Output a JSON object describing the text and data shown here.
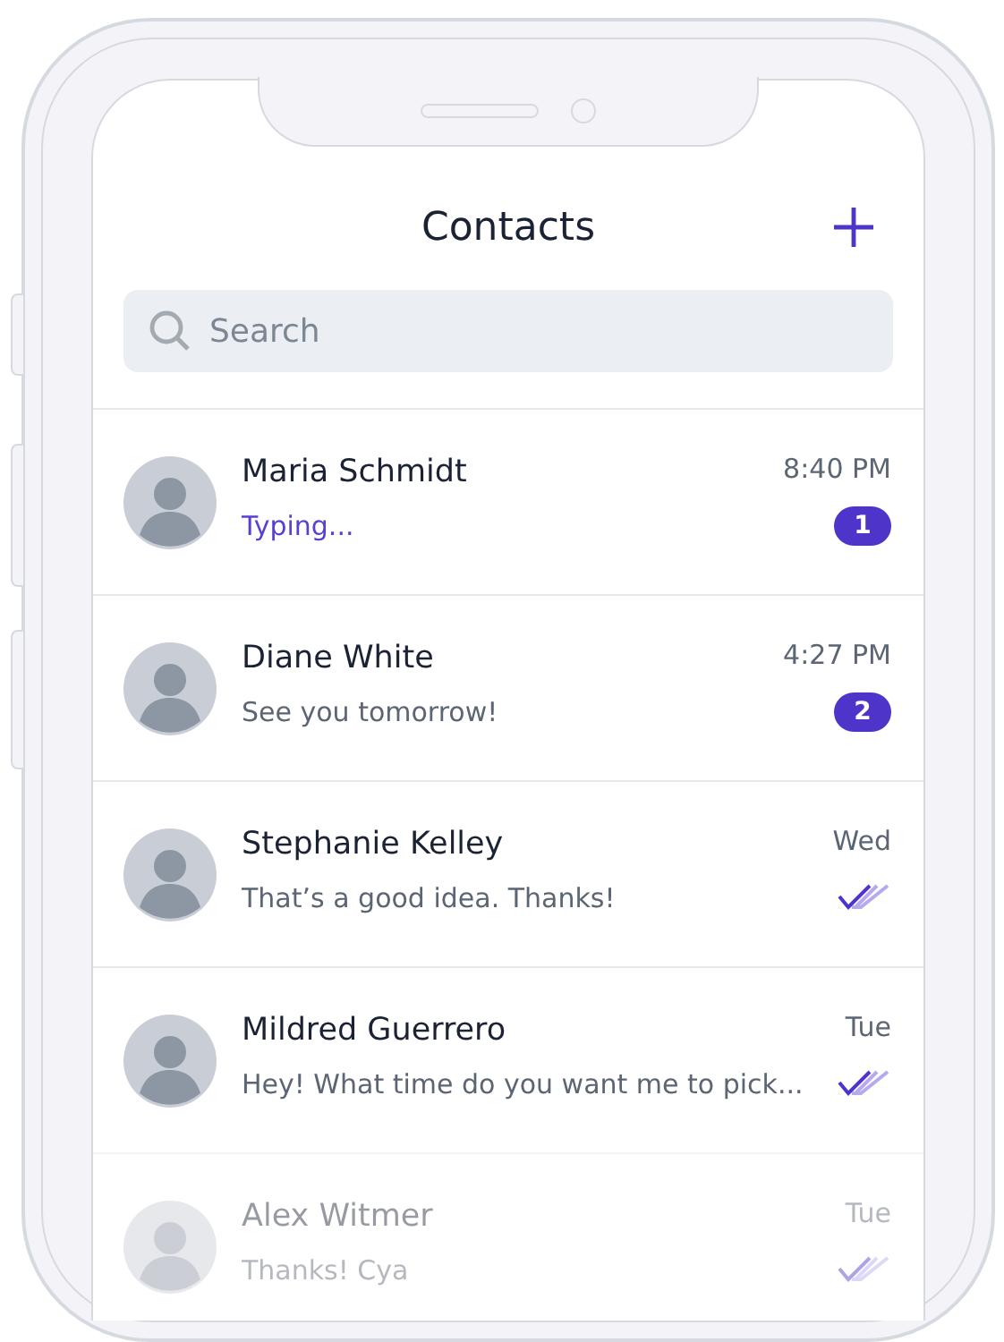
{
  "header": {
    "title": "Contacts"
  },
  "search": {
    "placeholder": "Search"
  },
  "contacts": [
    {
      "name": "Maria Schmidt",
      "message": "Typing...",
      "typing": true,
      "time": "8:40 PM",
      "faded": false,
      "status": {
        "kind": "unread",
        "count": "1"
      }
    },
    {
      "name": "Diane White",
      "message": "See you tomorrow!",
      "typing": false,
      "time": "4:27 PM",
      "faded": false,
      "status": {
        "kind": "unread",
        "count": "2"
      }
    },
    {
      "name": "Stephanie Kelley",
      "message": "That’s a good idea. Thanks!",
      "typing": false,
      "time": "Wed",
      "faded": false,
      "status": {
        "kind": "read"
      }
    },
    {
      "name": "Mildred Guerrero",
      "message": "Hey! What time do you want me to pick...",
      "typing": false,
      "time": "Tue",
      "faded": false,
      "status": {
        "kind": "read"
      }
    },
    {
      "name": "Alex Witmer",
      "message": "Thanks! Cya",
      "typing": false,
      "time": "Tue",
      "faded": true,
      "status": {
        "kind": "read"
      }
    }
  ]
}
